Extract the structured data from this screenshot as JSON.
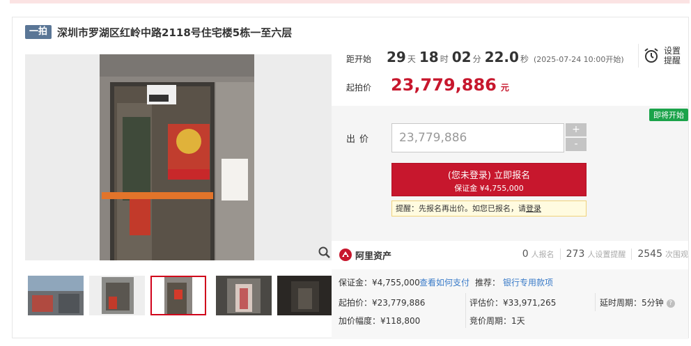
{
  "auction": {
    "tag": "一拍",
    "title": "深圳市罗湖区红岭中路2118号住宅楼5栋一至六层"
  },
  "countdown": {
    "label": "距开始",
    "days": "29",
    "days_unit": "天",
    "hours": "18",
    "hours_unit": "时",
    "minutes": "02",
    "minutes_unit": "分",
    "seconds": "22.0",
    "seconds_unit": "秒",
    "start_note": "(2025-07-24 10:00开始)"
  },
  "remind": {
    "line1": "设置",
    "line2": "提醒",
    "icon": "alarm-clock-icon"
  },
  "start_price": {
    "label": "起拍价",
    "value": "23,779,886",
    "unit": "元"
  },
  "bid": {
    "status_badge": "即将开始",
    "label": "出价",
    "input_value": "23,779,886",
    "plus": "+",
    "minus": "-",
    "signup_line1": "(您未登录) 立即报名",
    "signup_line2": "保证金 ¥4,755,000",
    "hint_prefix": "提醒：先报名再出价。如您已报名，请",
    "hint_link": "登录"
  },
  "platform": {
    "name": "阿里资产"
  },
  "stats": {
    "signups": "0",
    "signups_label": "人报名",
    "reminders": "273",
    "reminders_label": "人设置提醒",
    "views": "2545",
    "views_label": "次围观"
  },
  "details": {
    "deposit": "保证金：¥4,755,000",
    "how_to_pay": "查看如何支付",
    "recommend_label": "推荐：",
    "recommend_link": "银行专用款项",
    "start_price": "起拍价：¥23,779,886",
    "appraisal": "评估价：¥33,971,265",
    "delay_period": "延时周期：5分钟",
    "increment": "加价幅度：¥118,800",
    "bid_period": "竞价周期：1天"
  },
  "colors": {
    "accent": "#c7172d",
    "badge_green": "#1ba34a",
    "tag": "#5a7696",
    "link": "#3a7bc8"
  }
}
